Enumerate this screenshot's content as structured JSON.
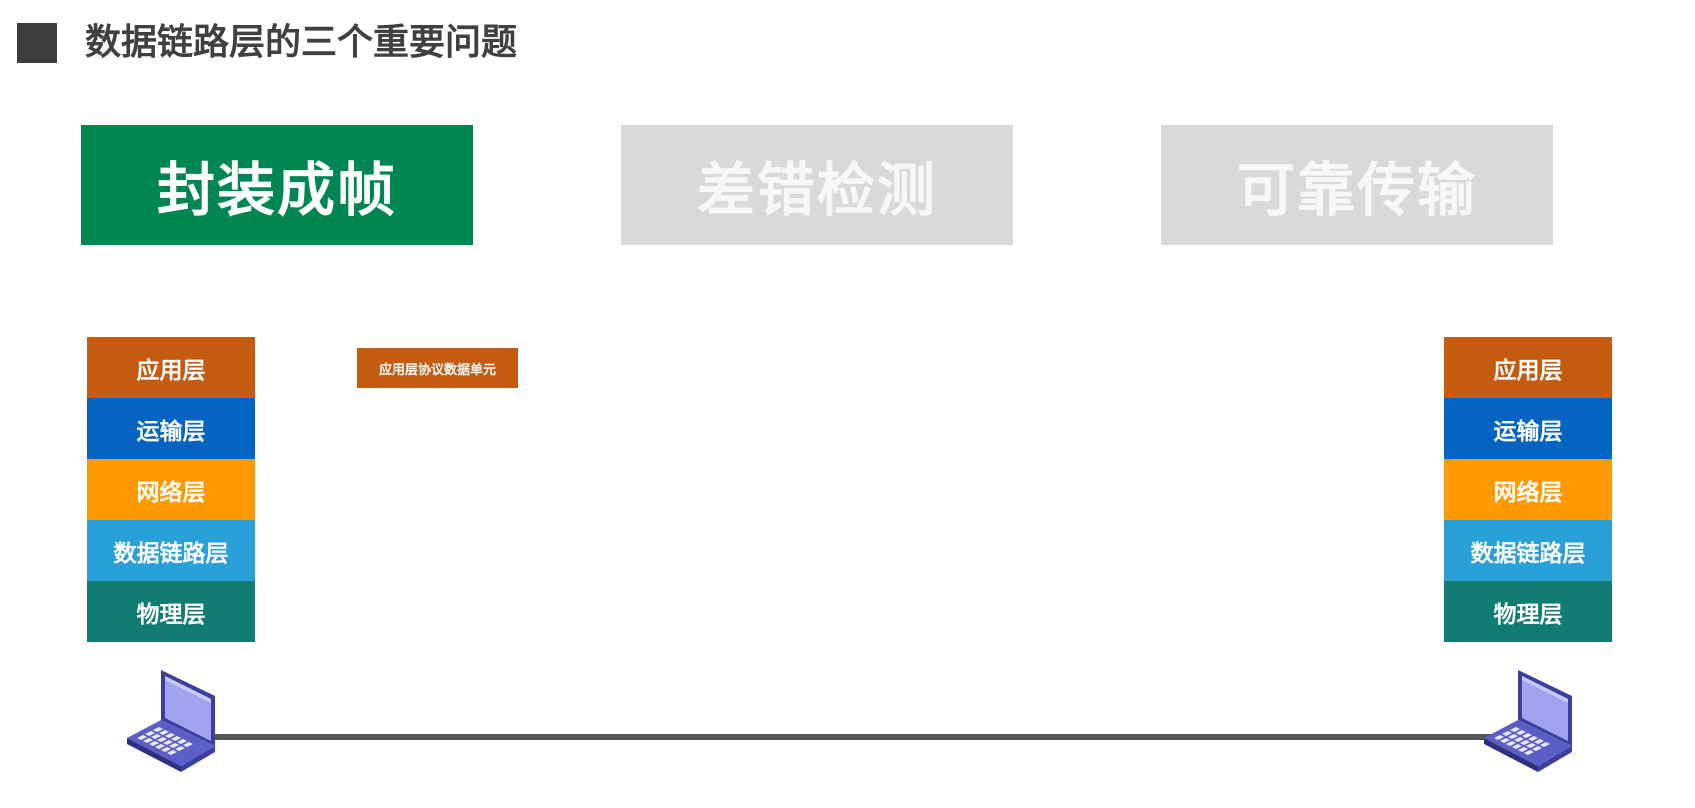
{
  "title": "数据链路层的三个重要问题",
  "topics": [
    {
      "label": "封装成帧",
      "state": "active"
    },
    {
      "label": "差错检测",
      "state": "inactive"
    },
    {
      "label": "可靠传输",
      "state": "inactive"
    }
  ],
  "colors": {
    "title_square": "#3d3d3d",
    "title_text": "#404040",
    "topic_active": "#008751",
    "topic_inactive": "#d9d9d9",
    "application_layer": "#c55a11",
    "transport_layer": "#0563c1",
    "network_layer": "#ff9900",
    "data_link_layer": "#29a0d8",
    "physical_layer": "#107c72",
    "link_line": "#555555",
    "laptop_body": "#5b5ec6"
  },
  "left_host": {
    "icon": "laptop-icon",
    "layers": [
      {
        "label": "应用层"
      },
      {
        "label": "运输层"
      },
      {
        "label": "网络层"
      },
      {
        "label": "数据链路层"
      },
      {
        "label": "物理层"
      }
    ]
  },
  "right_host": {
    "icon": "laptop-icon",
    "layers": [
      {
        "label": "应用层"
      },
      {
        "label": "运输层"
      },
      {
        "label": "网络层"
      },
      {
        "label": "数据链路层"
      },
      {
        "label": "物理层"
      }
    ]
  },
  "pdu": {
    "label": "应用层协议数据单元"
  }
}
